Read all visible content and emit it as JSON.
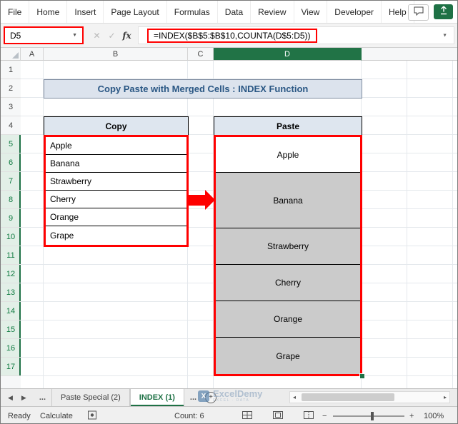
{
  "ribbon": {
    "tabs": [
      "File",
      "Home",
      "Insert",
      "Page Layout",
      "Formulas",
      "Data",
      "Review",
      "View",
      "Developer",
      "Help"
    ]
  },
  "toolbar_icons": {
    "comment": "speech-bubble-icon",
    "share": "share-up-arrow-icon"
  },
  "formula_bar": {
    "name_box_value": "D5",
    "cancel_glyph": "✕",
    "enter_glyph": "✓",
    "fx_label": "fx",
    "formula": "=INDEX($B$5:$B$10,COUNTA(D$5:D5))",
    "dropdown_glyph": "▼"
  },
  "grid": {
    "column_headers": [
      "A",
      "B",
      "C",
      "D"
    ],
    "row_headers": [
      "1",
      "2",
      "3",
      "4",
      "5",
      "6",
      "7",
      "8",
      "9",
      "10",
      "11",
      "12",
      "13",
      "14",
      "15",
      "16",
      "17"
    ],
    "selected_column": "D",
    "selected_rows": "5-17",
    "title": "Copy Paste with Merged Cells : INDEX Function",
    "copy_table": {
      "header": "Copy",
      "items": [
        "Apple",
        "Banana",
        "Strawberry",
        "Cherry",
        "Orange",
        "Grape"
      ]
    },
    "paste_table": {
      "header": "Paste",
      "items": [
        "Apple",
        "Banana",
        "Strawberry",
        "Cherry",
        "Orange",
        "Grape"
      ]
    }
  },
  "sheet_bar": {
    "prev_glyph": "◀",
    "next_glyph": "▶",
    "overflow_left": "...",
    "tabs": [
      {
        "label": "Paste Special (2)",
        "active": false
      },
      {
        "label": "INDEX (1)",
        "active": true
      }
    ],
    "overflow_right": "...",
    "add_glyph": "+",
    "scroll_left_glyph": "◂",
    "scroll_right_glyph": "▸"
  },
  "status_bar": {
    "mode": "Ready",
    "calculate": "Calculate",
    "count": "Count: 6",
    "zoom_out_glyph": "−",
    "zoom_in_glyph": "+",
    "zoom_level": "100%"
  },
  "watermark": {
    "logo": "X",
    "name": "ExcelDemy",
    "tagline": "EXCEL · DATA"
  },
  "colors": {
    "excel_green": "#217346",
    "annotation_red": "#FF0000",
    "title_text": "#2A5784",
    "header_fill": "#DEE6EF",
    "paste_fill": "#CBCBCB",
    "selected_header_fill": "#217346"
  }
}
